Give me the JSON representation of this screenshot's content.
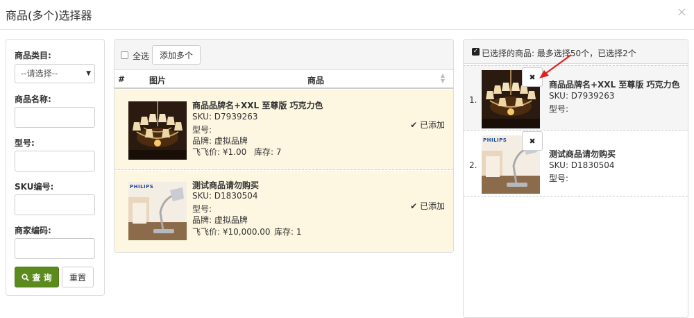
{
  "modal": {
    "title": "商品(多个)选择器",
    "close": "×"
  },
  "filter": {
    "category_label": "商品类目:",
    "category_selected": "--请选择--",
    "name_label": "商品名称:",
    "model_label": "型号:",
    "sku_label": "SKU编号:",
    "merchant_code_label": "商家编码:",
    "query_label": "查 询",
    "reset_label": "重置"
  },
  "product_list": {
    "select_all_label": "全选",
    "add_multiple_label": "添加多个",
    "columns": {
      "index": "#",
      "image": "图片",
      "product": "商品"
    },
    "rows": [
      {
        "name": "商品品牌名+XXL 至尊版 巧克力色",
        "sku": "SKU: D7939263",
        "model": "型号:",
        "brand": "品牌: 虚拟品牌",
        "price": "飞飞价: ¥1.00",
        "stock": "库存: 7",
        "status": "已添加"
      },
      {
        "name": "测试商品请勿购买",
        "sku": "SKU: D1830504",
        "model": "型号:",
        "brand": "品牌: 虚拟品牌",
        "price": "飞飞价: ¥10,000.00",
        "stock": "库存: 1",
        "status": "已添加"
      }
    ]
  },
  "selected": {
    "header": "已选择的商品: 最多选择50个，已选择2个",
    "items": [
      {
        "index": "1.",
        "name": "商品品牌名+XXL 至尊版 巧克力色",
        "sku": "SKU: D7939263",
        "model": "型号:"
      },
      {
        "index": "2.",
        "name": "测试商品请勿购买",
        "sku": "SKU: D1830504",
        "model": "型号:"
      }
    ]
  },
  "image_text": {
    "philips": "PHILIPS"
  },
  "colors": {
    "query_button": "#5b8a1d",
    "row_highlight": "#fdf7e2",
    "arrow": "#e02020"
  }
}
